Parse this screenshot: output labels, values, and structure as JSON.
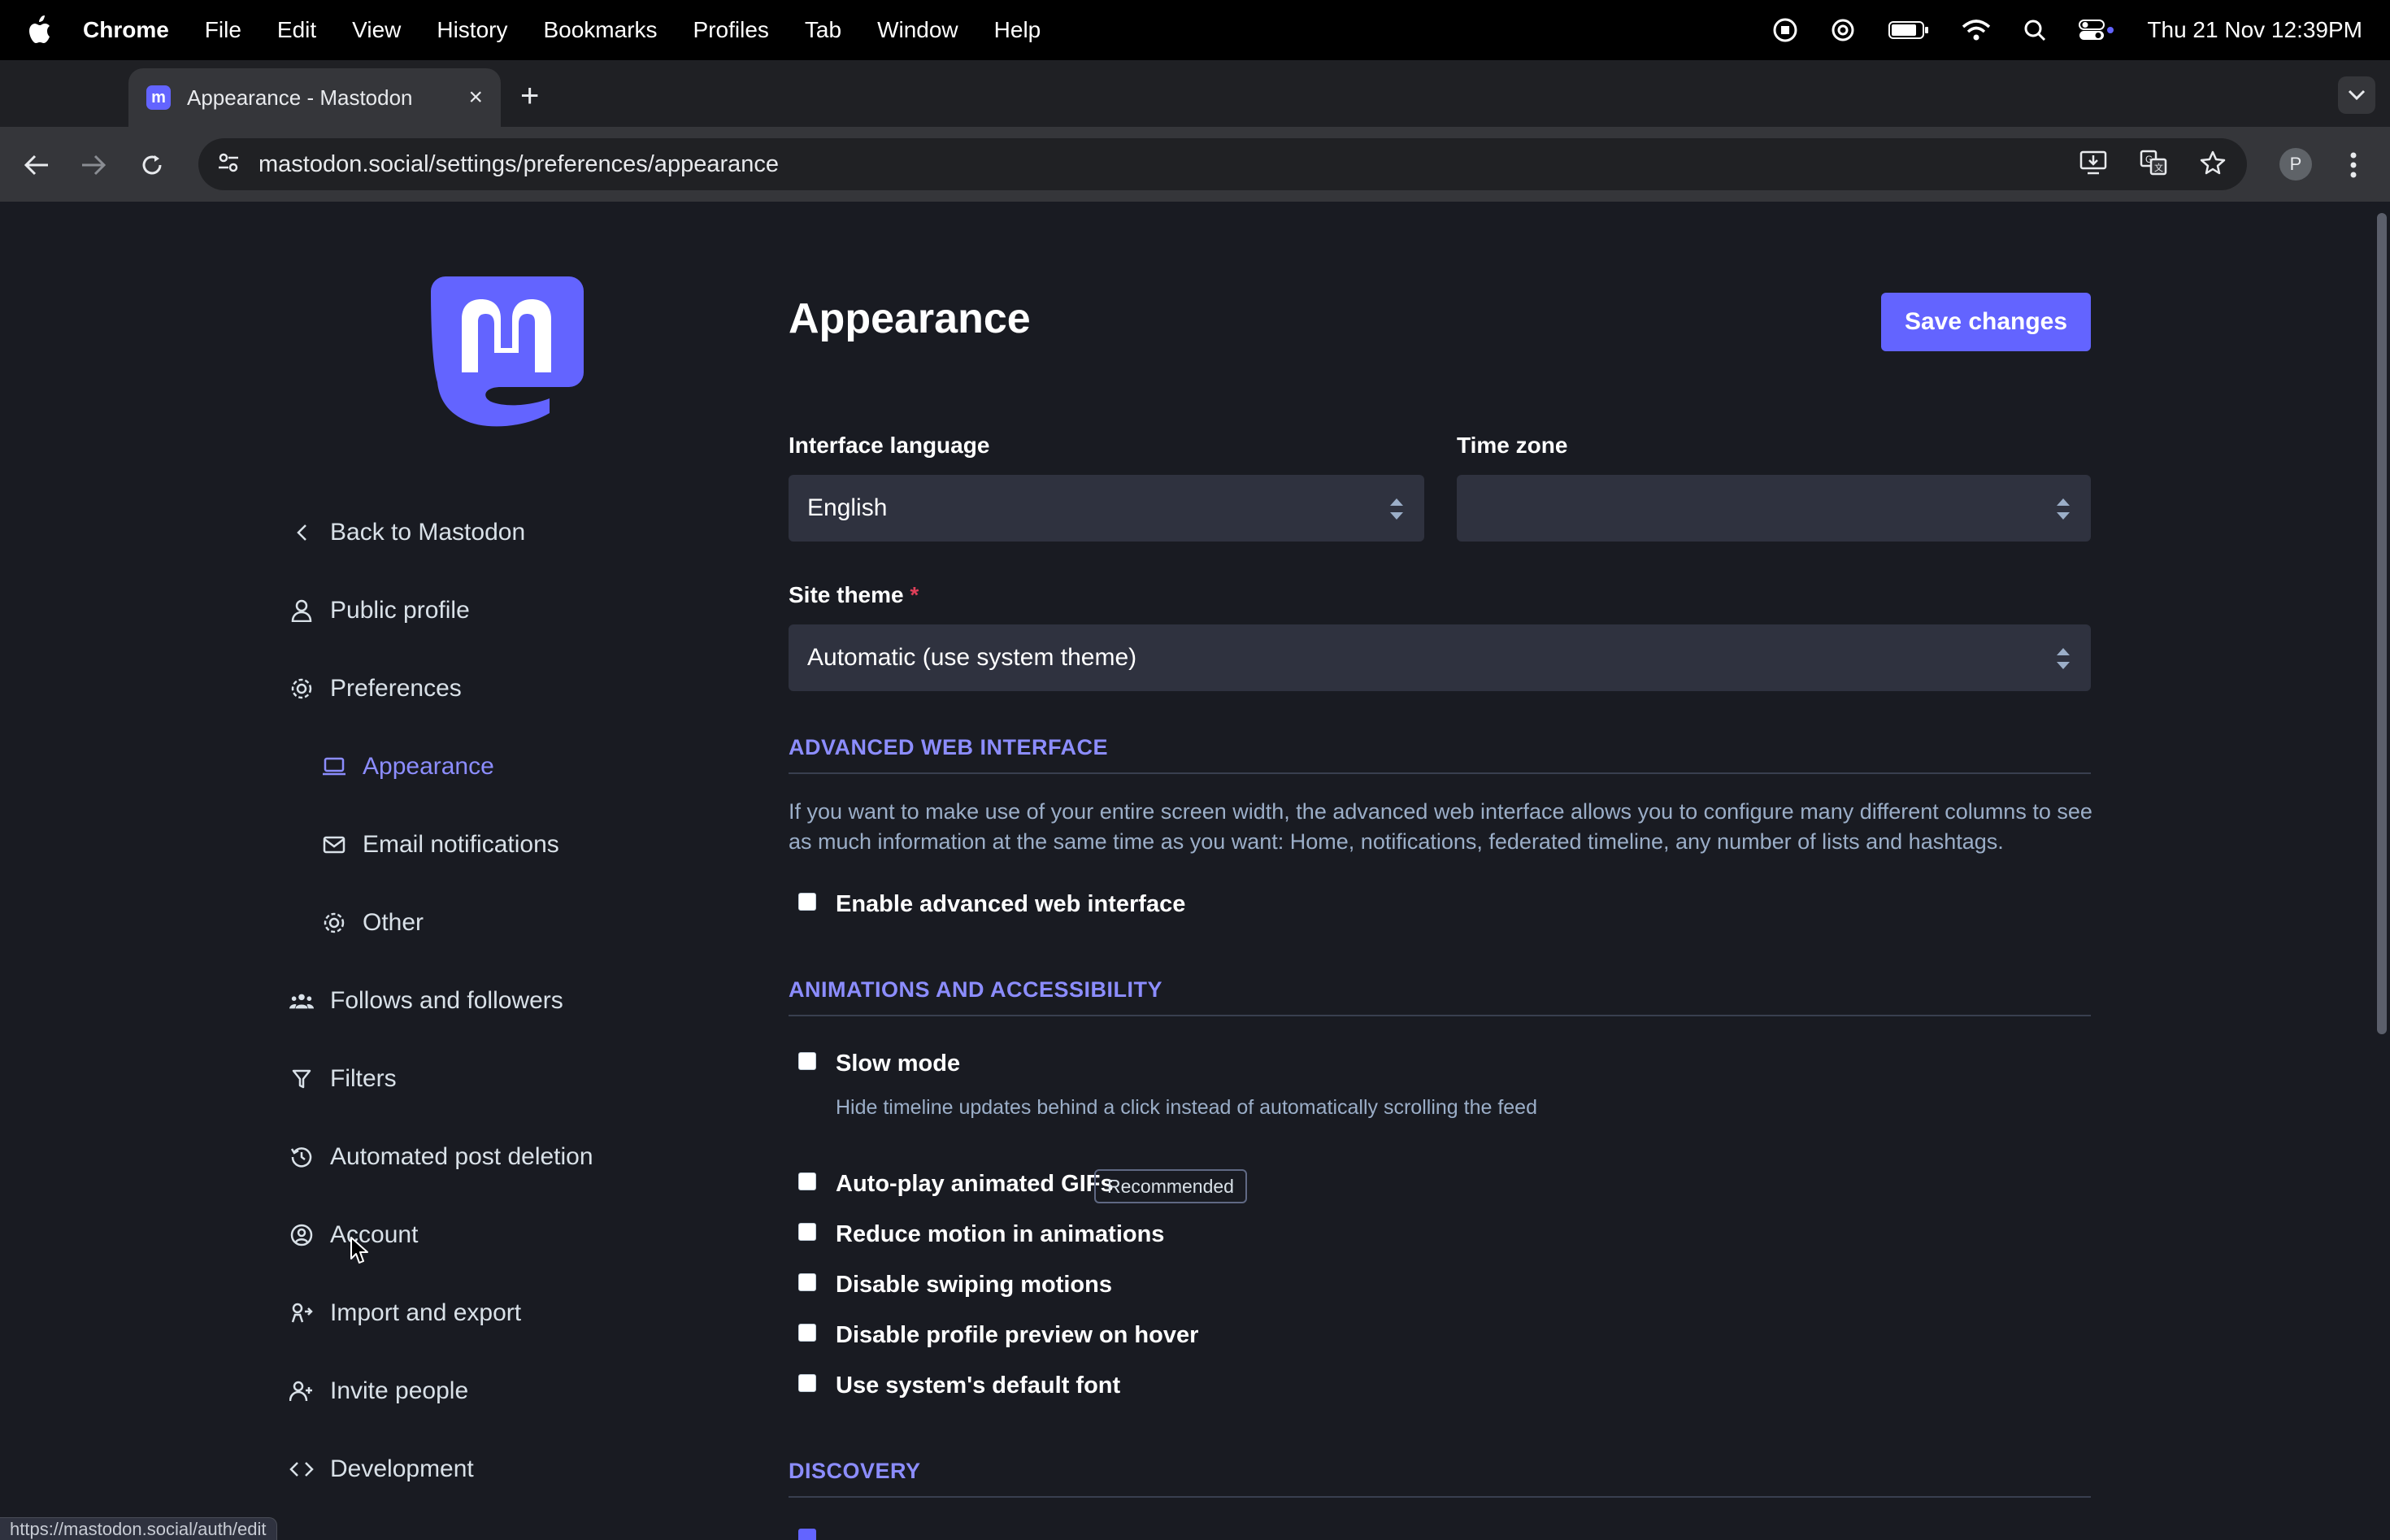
{
  "menubar": {
    "app_name": "Chrome",
    "items": [
      "File",
      "Edit",
      "View",
      "History",
      "Bookmarks",
      "Profiles",
      "Tab",
      "Window",
      "Help"
    ],
    "clock": "Thu 21 Nov  12:39PM"
  },
  "browser": {
    "tab_title": "Appearance - Mastodon",
    "url": "mastodon.social/settings/preferences/appearance",
    "profile_initial": "P",
    "status_url": "https://mastodon.social/auth/edit"
  },
  "sidebar": {
    "back": "Back to Mastodon",
    "items": [
      {
        "label": "Public profile",
        "icon": "person-icon"
      },
      {
        "label": "Preferences",
        "icon": "gear-icon"
      },
      {
        "label": "Appearance",
        "icon": "laptop-icon",
        "active": true
      },
      {
        "label": "Email notifications",
        "icon": "mail-icon"
      },
      {
        "label": "Other",
        "icon": "gear-icon"
      },
      {
        "label": "Follows and followers",
        "icon": "people-icon"
      },
      {
        "label": "Filters",
        "icon": "filter-icon"
      },
      {
        "label": "Automated post deletion",
        "icon": "history-icon"
      },
      {
        "label": "Account",
        "icon": "user-circle-icon"
      },
      {
        "label": "Import and export",
        "icon": "import-export-icon"
      },
      {
        "label": "Invite people",
        "icon": "person-add-icon"
      },
      {
        "label": "Development",
        "icon": "code-icon"
      }
    ]
  },
  "main": {
    "title": "Appearance",
    "save_label": "Save changes",
    "interface_language_label": "Interface language",
    "interface_language_value": "English",
    "time_zone_label": "Time zone",
    "time_zone_value": "",
    "site_theme_label": "Site theme",
    "site_theme_required_mark": "*",
    "site_theme_value": "Automatic (use system theme)",
    "advanced_heading": "ADVANCED WEB INTERFACE",
    "advanced_description": "If you want to make use of your entire screen width, the advanced web interface allows you to configure many different columns to see as much information at the same time as you want: Home, notifications, federated timeline, any number of lists and hashtags.",
    "enable_advanced_label": "Enable advanced web interface",
    "animations_heading": "ANIMATIONS AND ACCESSIBILITY",
    "slow_mode_label": "Slow mode",
    "slow_mode_hint": "Hide timeline updates behind a click instead of automatically scrolling the feed",
    "autoplay_label": "Auto-play animated GIFs",
    "recommended_badge": "Recommended",
    "reduce_motion_label": "Reduce motion in animations",
    "disable_swiping_label": "Disable swiping motions",
    "disable_preview_label": "Disable profile preview on hover",
    "system_font_label": "Use system's default font",
    "discovery_heading": "DISCOVERY"
  },
  "colors": {
    "accent": "#6364ff",
    "accent_text": "#8c8dff",
    "background": "#191b22",
    "input_bg": "#2f323f"
  }
}
